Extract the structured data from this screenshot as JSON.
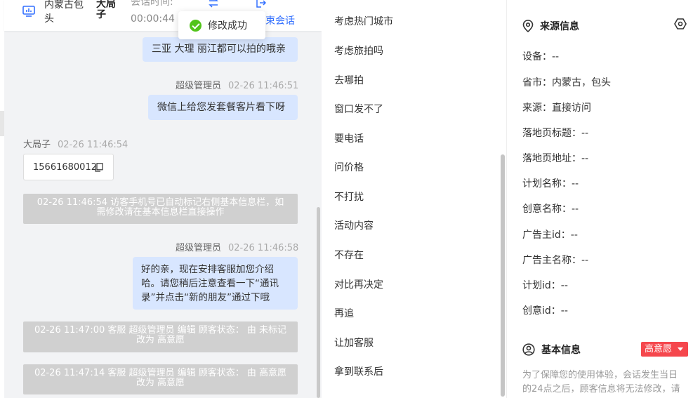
{
  "header": {
    "source_name": "内蒙古包头",
    "customer_name": "大局子",
    "session_label": "会话时间:",
    "session_time": "00:00:44",
    "end_label": "结束会话",
    "end_label_visible": "束会话",
    "icons": [
      "monitor-icon",
      "swap-icon",
      "exit-icon"
    ]
  },
  "toast": {
    "text": "修改成功",
    "icon": "check-circle-icon",
    "color": "#52c41a"
  },
  "messages": {
    "m1": {
      "text": "三亚 大理 丽江都可以拍的哦亲"
    },
    "m2": {
      "sender": "超级管理员",
      "time": "02-26 11:46:51",
      "text": "微信上给您发套餐客片看下呀"
    },
    "m3": {
      "sender": "大局子",
      "time": "02-26 11:46:54",
      "phone": "15661680012"
    },
    "sys1": {
      "text": "02-26 11:46:54 访客手机号已自动标记右侧基本信息栏，如需修改请在基本信息栏直接操作"
    },
    "m4": {
      "sender": "超级管理员",
      "time": "02-26 11:46:58",
      "text": "好的亲，现在安排客服加您介绍哈。请您稍后注意查看一下“通讯录”并点击“新的朋友”通过下哦"
    },
    "sys2": {
      "text": "02-26 11:47:00 客服 超级管理员 编辑 顾客状态： 由 未标记 改为 高意愿"
    },
    "sys3": {
      "text": "02-26 11:47:14 客服 超级管理员 编辑 顾客状态： 由 高意愿 改为 高意愿"
    }
  },
  "quick_replies": [
    "考虑热门城市",
    "考虑旅拍吗",
    "去哪拍",
    "窗口发不了",
    "要电话",
    "问价格",
    "不打扰",
    "活动内容",
    "不存在",
    "对比再决定",
    "再追",
    "让加客服",
    "拿到联系后"
  ],
  "info": {
    "source_title": "来源信息",
    "fields": [
      "设备：--",
      "省市：内蒙古，包头",
      "来源：直接访问",
      "落地页标题：--",
      "落地页地址：--",
      "计划名称：--",
      "创意名称：--",
      "广告主id：--",
      "广告主名称：--",
      "计划id：--",
      "创意id：--"
    ],
    "basic_title": "基本信息",
    "intent_badge": "高意愿",
    "intent_color": "#f5474d",
    "notice": "为了保障您的使用体验，会话发生当日的24点之后，顾客信息将无法修改，请"
  },
  "accent_color": "#3370ff",
  "bubble_color": "#d8e6ff"
}
